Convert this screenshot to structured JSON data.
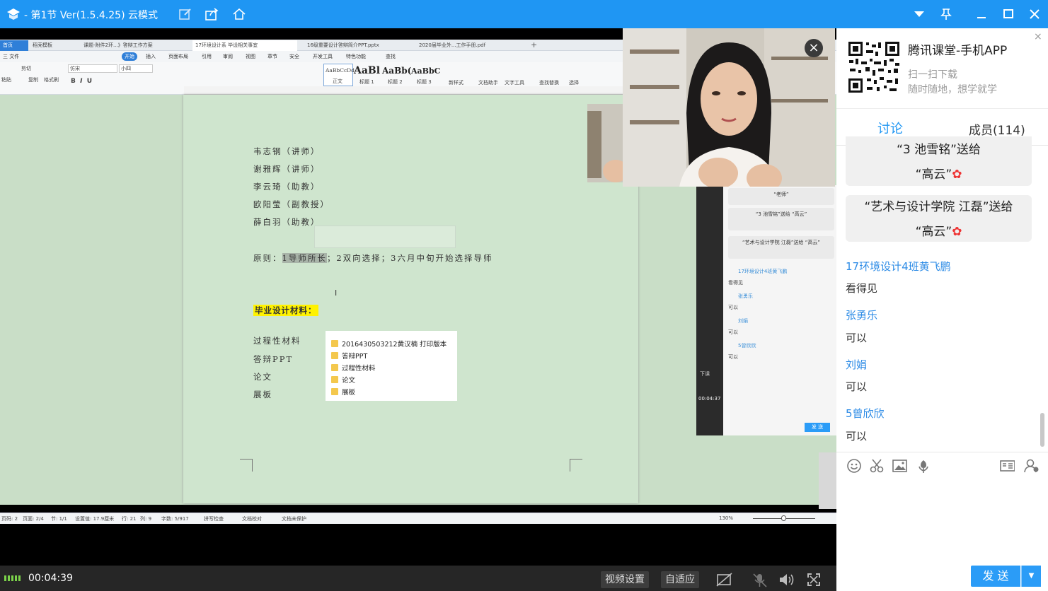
{
  "titlebar": {
    "title": "- 第1节 Ver(1.5.4.25)  云模式"
  },
  "wps": {
    "tabs": [
      "首页",
      "稻壳模板",
      "课题-附件2环...》答辩工作方案",
      "17环境设计系 毕设相关事宜",
      "16级重要设计答辩简介PPT.pptx",
      "2020届毕业外...工作手册.pdf"
    ],
    "menus": [
      "三 文件",
      "开始",
      "插入",
      "页面布局",
      "引用",
      "审阅",
      "视图",
      "章节",
      "安全",
      "开发工具",
      "特色功能",
      "查找"
    ],
    "ribbon": {
      "font_name": "仿宋",
      "font_size": "小四",
      "clipboard": [
        "剪切",
        "复制",
        "格式刷",
        "粘贴"
      ],
      "styles": [
        "正文",
        "标题 1",
        "标题 2",
        "标题 3"
      ],
      "style_previews": [
        "AaBbCcDd",
        "AaBl",
        "AaBb(",
        "AaBbC"
      ],
      "actions": [
        "新样式",
        "文档助手",
        "文字工具",
        "查找替换",
        "选择"
      ]
    },
    "document": {
      "lines": [
        "韦志钢（讲师）",
        "谢雅辉（讲师）",
        "李云琦（助教）",
        "欧阳莹（副教授）",
        "薛白羽（助教）"
      ],
      "principle_prefix": "原则：",
      "principle_highlight": "1导师所长",
      "principle_rest": "；2双向选择；3六月中旬开始选择导师",
      "materials_heading": "毕业设计材料：",
      "materials": [
        "过程性材料",
        "答辩PPT",
        "论文",
        "展板"
      ],
      "folder_items": [
        "2016430503212黄汉楠  打印版本",
        "答辩PPT",
        "过程性材料",
        "论文",
        "展板"
      ]
    },
    "statusbar": {
      "page": "页码: 2",
      "pages": "页面: 2/4",
      "section": "节: 1/1",
      "setting": "设置值: 17.9厘米",
      "row": "行: 21",
      "col": "列: 9",
      "words": "字数: 5/917",
      "spell": "拼写检查",
      "proof": "文档校对",
      "protect": "文档未保护",
      "zoom": "130%"
    }
  },
  "inner_chat": {
    "gifts": [
      "“老师”",
      "“3 池雪铭”送给 “高云”",
      "“艺术与设计学院 江磊”送给 “高云”"
    ],
    "messages": [
      {
        "name": "17环境设计4班黄飞鹏",
        "text": "看得见"
      },
      {
        "name": "张勇乐",
        "text": "可以"
      },
      {
        "name": "刘娟",
        "text": "可以"
      },
      {
        "name": "5曾欣欣",
        "text": "可以"
      }
    ],
    "timer": "00:04:37",
    "send": "发 送",
    "side_label": "下课"
  },
  "bottom": {
    "time": "00:04:39",
    "video_settings": "视频设置",
    "auto_fit": "自适应"
  },
  "right_panel": {
    "app_name": "腾讯课堂-手机APP",
    "scan": "扫一扫下载",
    "slogan": "随时随地，想学就学",
    "tab_discuss": "讨论",
    "tab_members": "成员(114)",
    "gift1_line1": "“3 池雪铭”送给",
    "gift1_line2": "“高云”",
    "gift2_line1": "“艺术与设计学院 江磊”送给",
    "gift2_line2": "“高云”",
    "messages": [
      {
        "name": "17环境设计4班黄飞鹏",
        "text": "看得见"
      },
      {
        "name": "张勇乐",
        "text": "可以"
      },
      {
        "name": "刘娟",
        "text": "可以"
      },
      {
        "name": "5曾欣欣",
        "text": "可以"
      }
    ],
    "send": "发 送"
  },
  "colors": {
    "brand": "#1f96f3",
    "name_blue": "#2c8be6",
    "doc_green": "#cfe5ce",
    "highlight_yellow": "#fff200"
  },
  "icons": [
    "app-logo-icon",
    "edit-icon",
    "share-icon",
    "home-icon",
    "dropdown-icon",
    "pin-icon",
    "minimize-icon",
    "maximize-icon",
    "close-icon",
    "emoji-icon",
    "scissors-icon",
    "image-icon",
    "flower-icon",
    "card-icon",
    "user-icon",
    "mic-off-icon",
    "volume-icon",
    "fullscreen-icon",
    "camera-off-icon",
    "signal-icon"
  ]
}
